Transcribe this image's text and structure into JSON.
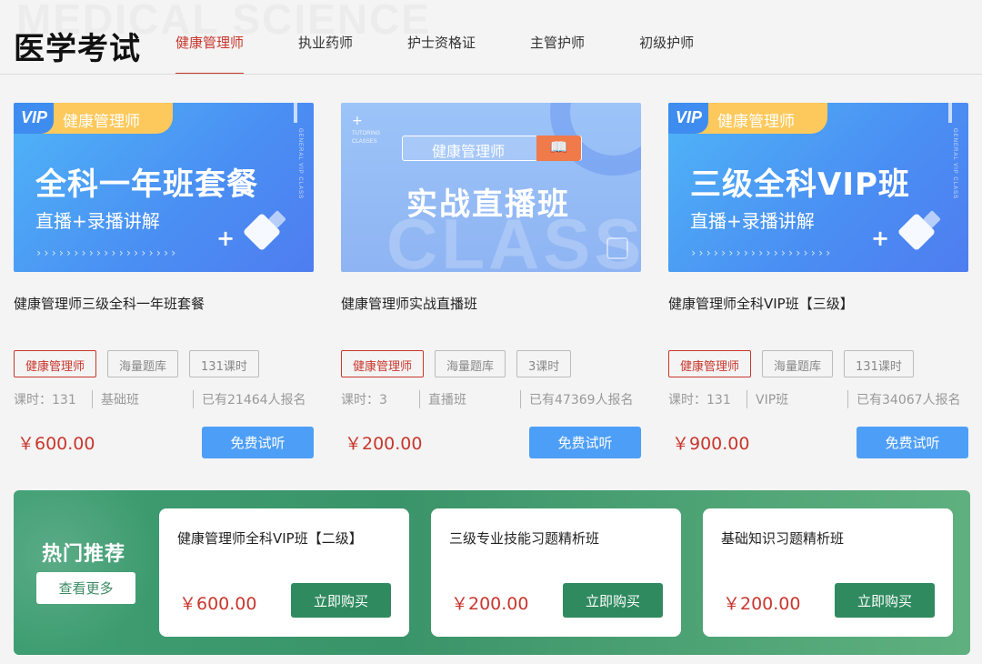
{
  "header": {
    "bg_text": "MEDICAL SCIENCE",
    "title": "医学考试",
    "tabs": [
      "健康管理师",
      "执业药师",
      "护士资格证",
      "主管护师",
      "初级护师"
    ]
  },
  "courses": [
    {
      "banner": {
        "badge": "健康管理师",
        "vip_logo": "VIP",
        "main": "全科一年班套餐",
        "sub": "直播+录播讲解",
        "side_text": "GENERAL VIP CLASS",
        "arrows": "›››››››››››››››››››",
        "plus": "+"
      },
      "title": "健康管理师三级全科一年班套餐",
      "tags": [
        "健康管理师",
        "海量题库",
        "131课时"
      ],
      "hours": "课时：131",
      "type": "基础班",
      "enrolled": "已有21464人报名",
      "price": "￥600.00",
      "button": "免费试听"
    },
    {
      "banner": {
        "pill": "健康管理师",
        "pill_icon": "📖",
        "main": "实战直播班",
        "ghost": "CLASS",
        "side_text": "TUTORING CLASSES",
        "plus": "+"
      },
      "title": "健康管理师实战直播班",
      "tags": [
        "健康管理师",
        "海量题库",
        "3课时"
      ],
      "hours": "课时：3",
      "type": "直播班",
      "enrolled": "已有47369人报名",
      "price": "￥200.00",
      "button": "免费试听"
    },
    {
      "banner": {
        "badge": "健康管理师",
        "vip_logo": "VIP",
        "main": "三级全科VIP班",
        "sub": "直播+录播讲解",
        "side_text": "GENERAL VIP CLASS",
        "arrows": "›››››››››››››››››››",
        "plus": "+"
      },
      "title": "健康管理师全科VIP班【三级】",
      "tags": [
        "健康管理师",
        "海量题库",
        "131课时"
      ],
      "hours": "课时：131",
      "type": "VIP班",
      "enrolled": "已有34067人报名",
      "price": "￥900.00",
      "button": "免费试听"
    }
  ],
  "hot": {
    "title": "热门推荐",
    "more": "查看更多",
    "items": [
      {
        "title": "健康管理师全科VIP班【二级】",
        "price": "￥600.00",
        "button": "立即购买"
      },
      {
        "title": "三级专业技能习题精析班",
        "price": "￥200.00",
        "button": "立即购买"
      },
      {
        "title": "基础知识习题精析班",
        "price": "￥200.00",
        "button": "立即购买"
      }
    ]
  },
  "colors": {
    "accent_red": "#c8372d",
    "button_blue": "#4d9ef6",
    "hot_green": "#3a9469",
    "buy_green": "#2f8a5f"
  }
}
